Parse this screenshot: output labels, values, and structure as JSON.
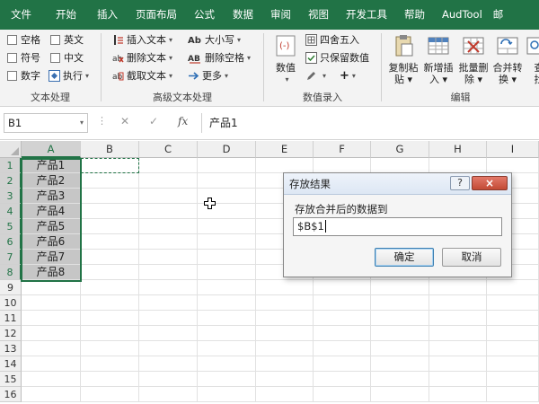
{
  "menu": [
    "文件",
    "开始",
    "插入",
    "页面布局",
    "公式",
    "数据",
    "审阅",
    "视图",
    "开发工具",
    "帮助",
    "AudTool",
    "邮"
  ],
  "ribbon": {
    "text_group": {
      "label": "文本处理",
      "checkboxes": [
        "空格",
        "英文",
        "符号",
        "中文",
        "数字"
      ],
      "execute": "执行"
    },
    "advanced_group": {
      "label": "高级文本处理",
      "items": [
        "插入文本",
        "删除文本",
        "截取文本",
        "大小写",
        "删除空格",
        "更多"
      ]
    },
    "numeric_group": {
      "label": "数值录入",
      "value_button": "数值",
      "round_button": "四舍五入",
      "keep_value_button": "只保留数值",
      "plus": "+"
    },
    "edit_group": {
      "label": "编辑",
      "buttons": [
        "复制粘贴",
        "新增插入",
        "批量删除",
        "合并转换",
        "查找"
      ]
    }
  },
  "formula_bar": {
    "name_box": "B1",
    "fx": "fx",
    "content": "产品1"
  },
  "sheet": {
    "columns": [
      "A",
      "B",
      "C",
      "D",
      "E",
      "F",
      "G",
      "H",
      "I"
    ],
    "rows": [
      "1",
      "2",
      "3",
      "4",
      "5",
      "6",
      "7",
      "8",
      "9",
      "10",
      "11",
      "12",
      "13",
      "14",
      "15",
      "16"
    ],
    "column_a_values": [
      "产品1",
      "产品2",
      "产品3",
      "产品4",
      "产品5",
      "产品6",
      "产品7",
      "产品8"
    ]
  },
  "dialog": {
    "title": "存放结果",
    "help": "?",
    "close": "×",
    "prompt": "存放合并后的数据到",
    "input_value": "$B$1",
    "ok": "确定",
    "cancel": "取消"
  },
  "colors": {
    "menubar": "#217346",
    "selection_border": "#217346",
    "selected_fill": "#c6c6c6"
  }
}
